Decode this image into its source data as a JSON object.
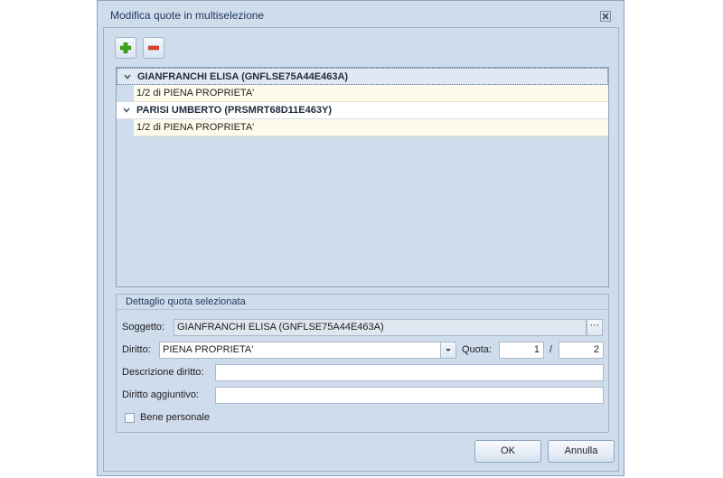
{
  "dialog": {
    "title": "Modifica quote in multiselezione",
    "close_icon": "close-icon"
  },
  "toolbar": {
    "add_icon": "plus-icon",
    "remove_icon": "minus-icon",
    "add_color": "#3ea21b",
    "remove_color": "#e0442c"
  },
  "grid": {
    "groups": [
      {
        "label": "GIANFRANCHI ELISA (GNFLSE75A44E463A)",
        "selected": true,
        "rows": [
          "1/2 di PIENA PROPRIETA'"
        ]
      },
      {
        "label": "PARISI UMBERTO (PRSMRT68D11E463Y)",
        "selected": false,
        "rows": [
          "1/2 di PIENA PROPRIETA'"
        ]
      }
    ]
  },
  "detail": {
    "title": "Dettaglio quota selezionata",
    "soggetto_label": "Soggetto:",
    "soggetto_value": "GIANFRANCHI ELISA (GNFLSE75A44E463A)",
    "soggetto_button": "···",
    "diritto_label": "Diritto:",
    "diritto_value": "PIENA PROPRIETA'",
    "quota_label": "Quota:",
    "quota_num": "1",
    "quota_sep": "/",
    "quota_den": "2",
    "descrizione_label": "Descrizione diritto:",
    "descrizione_value": "",
    "aggiuntivo_label": "Diritto aggiuntivo:",
    "aggiuntivo_value": "",
    "bene_label": "Bene personale",
    "bene_checked": false
  },
  "buttons": {
    "ok": "OK",
    "cancel": "Annulla"
  }
}
